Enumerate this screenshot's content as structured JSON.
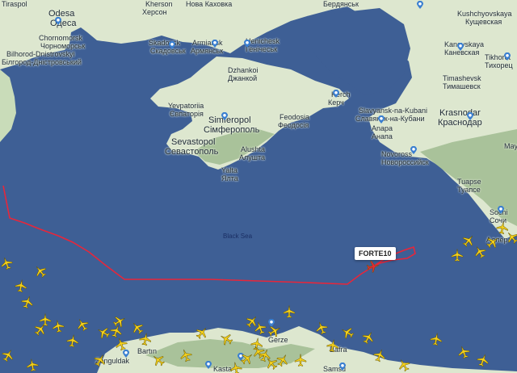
{
  "map": {
    "sea_label": "Black Sea",
    "colors": {
      "sea": "#3e5f95",
      "land": "#dde7cf",
      "hills": "#a9c29a",
      "track": "#e8263a",
      "aircraft": "#f4d01c"
    },
    "places": [
      {
        "id": "tiraspol",
        "text": "Tiraspol"
      },
      {
        "id": "odesa",
        "text": "Odesa"
      },
      {
        "id": "odesa_cyr",
        "text": "Одеса"
      },
      {
        "id": "chornomorsk",
        "text": "Chornomorsk"
      },
      {
        "id": "chornomorsk_cyr",
        "text": "Чорноморськ"
      },
      {
        "id": "bilhorod",
        "text": "Bilhorod-Dnistrovskyi"
      },
      {
        "id": "bilhorod_cyr",
        "text": "Білгород-Дністровський"
      },
      {
        "id": "kherson",
        "text": "Kherson"
      },
      {
        "id": "kherson_cyr",
        "text": "Херсон"
      },
      {
        "id": "kakhovka",
        "text": "Нова Каховка"
      },
      {
        "id": "berdiansk",
        "text": "Бердянськ"
      },
      {
        "id": "skadovsk",
        "text": "Skadovsk"
      },
      {
        "id": "skadovsk_cyr",
        "text": "Скадовськ"
      },
      {
        "id": "armiansk",
        "text": "Armiansk"
      },
      {
        "id": "armiansk_cyr",
        "text": "Армянськ"
      },
      {
        "id": "henichesk",
        "text": "Henichesk"
      },
      {
        "id": "henichesk_cyr",
        "text": "Генічеськ"
      },
      {
        "id": "dzhankoi",
        "text": "Dzhankoi"
      },
      {
        "id": "dzhankoi_cyr",
        "text": "Джанкой"
      },
      {
        "id": "yevpatoriia",
        "text": "Yevpatoriia"
      },
      {
        "id": "yevpatoriia_cyr",
        "text": "Євпаторія"
      },
      {
        "id": "simferopol",
        "text": "Simferopol"
      },
      {
        "id": "simferopol_cyr",
        "text": "Сімферополь"
      },
      {
        "id": "sevastopol",
        "text": "Sevastopol"
      },
      {
        "id": "sevastopol_cyr",
        "text": "Севастополь"
      },
      {
        "id": "alushta",
        "text": "Alushta"
      },
      {
        "id": "alushta_cyr",
        "text": "Алушта"
      },
      {
        "id": "yalta",
        "text": "Yalta"
      },
      {
        "id": "yalta_cyr",
        "text": "Ялта"
      },
      {
        "id": "feodosia",
        "text": "Feodosia"
      },
      {
        "id": "feodosia_cyr",
        "text": "Феодосія"
      },
      {
        "id": "kerch",
        "text": "Kerch"
      },
      {
        "id": "kerch_cyr",
        "text": "Керч"
      },
      {
        "id": "slavyansk",
        "text": "Slavyansk-na-Kubani"
      },
      {
        "id": "slavyansk_cyr",
        "text": "Славянск-на-Кубани"
      },
      {
        "id": "anapa",
        "text": "Anapa"
      },
      {
        "id": "anapa_cyr",
        "text": "Анапа"
      },
      {
        "id": "novoross",
        "text": "Novoross"
      },
      {
        "id": "novoross_cyr",
        "text": "Новороссийск"
      },
      {
        "id": "kushchevskaya",
        "text": "Kushchyovskaya"
      },
      {
        "id": "kushchevskaya_cyr",
        "text": "Кущевская"
      },
      {
        "id": "kanevskaya",
        "text": "Kanevskaya"
      },
      {
        "id": "kanevskaya_cyr",
        "text": "Каневская"
      },
      {
        "id": "tikhoretsk",
        "text": "Tikhoret"
      },
      {
        "id": "tikhoretsk_cyr",
        "text": "Тихорец"
      },
      {
        "id": "timashevsk",
        "text": "Timashevsk"
      },
      {
        "id": "timashevsk_cyr",
        "text": "Тимашевск"
      },
      {
        "id": "krasnodar",
        "text": "Krasnodar"
      },
      {
        "id": "krasnodar_cyr",
        "text": "Краснодар"
      },
      {
        "id": "tuapse",
        "text": "Tuapse"
      },
      {
        "id": "tuapse_cyr",
        "text": "Туапсе"
      },
      {
        "id": "sochi",
        "text": "Sochi"
      },
      {
        "id": "sochi_cyr",
        "text": "Сочи"
      },
      {
        "id": "adler",
        "text": "Адлер"
      },
      {
        "id": "may",
        "text": "May"
      },
      {
        "id": "bartin",
        "text": "Bartın"
      },
      {
        "id": "zonguldak",
        "text": "Zonguldak"
      },
      {
        "id": "gerze",
        "text": "Gerze"
      },
      {
        "id": "bafra",
        "text": "Bafra"
      },
      {
        "id": "kastamonu",
        "text": "Kasta"
      },
      {
        "id": "samsun",
        "text": "Samsu"
      }
    ],
    "tracked_flight": {
      "callsign": "FORTE10"
    },
    "aircraft_count": 50
  }
}
